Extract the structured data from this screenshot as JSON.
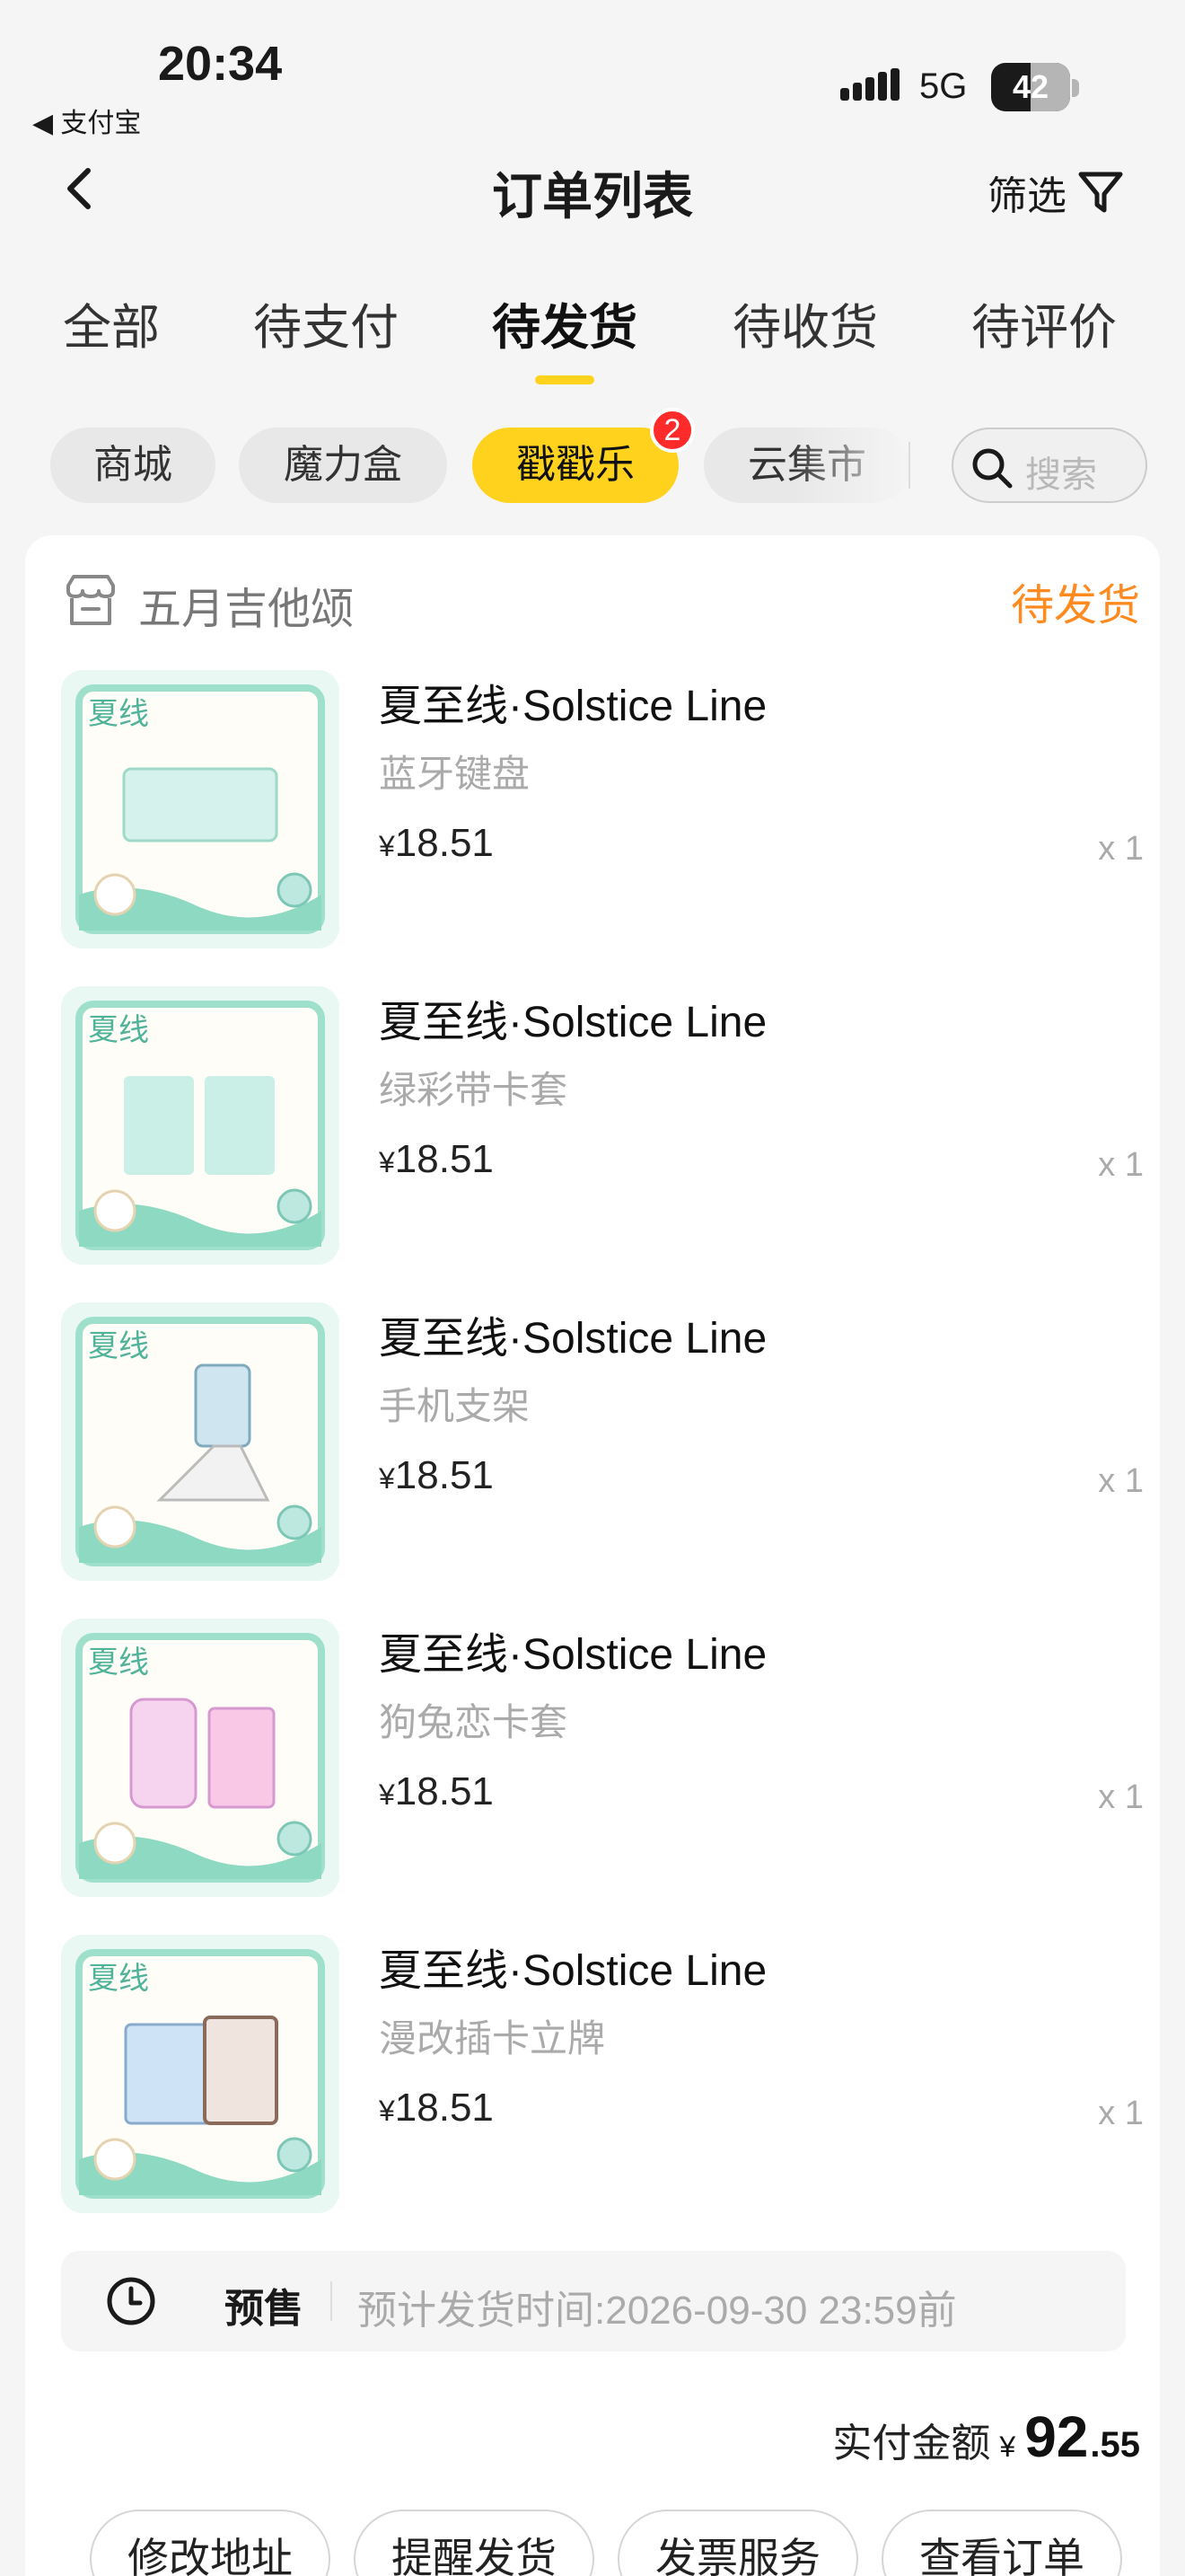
{
  "status_bar": {
    "time": "20:34",
    "back_app": "◀ 支付宝",
    "network": "5G",
    "battery": "42"
  },
  "nav": {
    "title": "订单列表",
    "filter_label": "筛选"
  },
  "tabs": [
    {
      "label": "全部",
      "active": false
    },
    {
      "label": "待支付",
      "active": false
    },
    {
      "label": "待发货",
      "active": true
    },
    {
      "label": "待收货",
      "active": false
    },
    {
      "label": "待评价",
      "active": false
    }
  ],
  "chips": [
    {
      "label": "商城",
      "active": false
    },
    {
      "label": "魔力盒",
      "active": false
    },
    {
      "label": "戳戳乐",
      "active": true,
      "badge": "2"
    },
    {
      "label": "云集市",
      "active": false
    }
  ],
  "search": {
    "placeholder": "搜索"
  },
  "order": {
    "store_name": "五月吉他颂",
    "status": "待发货",
    "items": [
      {
        "title": "夏至线·Solstice Line",
        "subtitle": "蓝牙键盘",
        "currency": "¥",
        "price": "18.51",
        "qty": "x 1"
      },
      {
        "title": "夏至线·Solstice Line",
        "subtitle": "绿彩带卡套",
        "currency": "¥",
        "price": "18.51",
        "qty": "x 1"
      },
      {
        "title": "夏至线·Solstice Line",
        "subtitle": "手机支架",
        "currency": "¥",
        "price": "18.51",
        "qty": "x 1"
      },
      {
        "title": "夏至线·Solstice Line",
        "subtitle": "狗兔恋卡套",
        "currency": "¥",
        "price": "18.51",
        "qty": "x 1"
      },
      {
        "title": "夏至线·Solstice Line",
        "subtitle": "漫改插卡立牌",
        "currency": "¥",
        "price": "18.51",
        "qty": "x 1"
      }
    ],
    "presale": {
      "label": "预售",
      "text": "预计发货时间:2026-09-30 23:59前"
    },
    "total": {
      "label": "实付金额",
      "currency": "¥",
      "integer": "92",
      "decimal": ".55"
    },
    "actions": [
      "修改地址",
      "提醒发货",
      "发票服务",
      "查看订单"
    ]
  },
  "colors": {
    "accent": "#ffd21e",
    "status": "#ff8a1f",
    "badge": "#ff2b2b"
  }
}
